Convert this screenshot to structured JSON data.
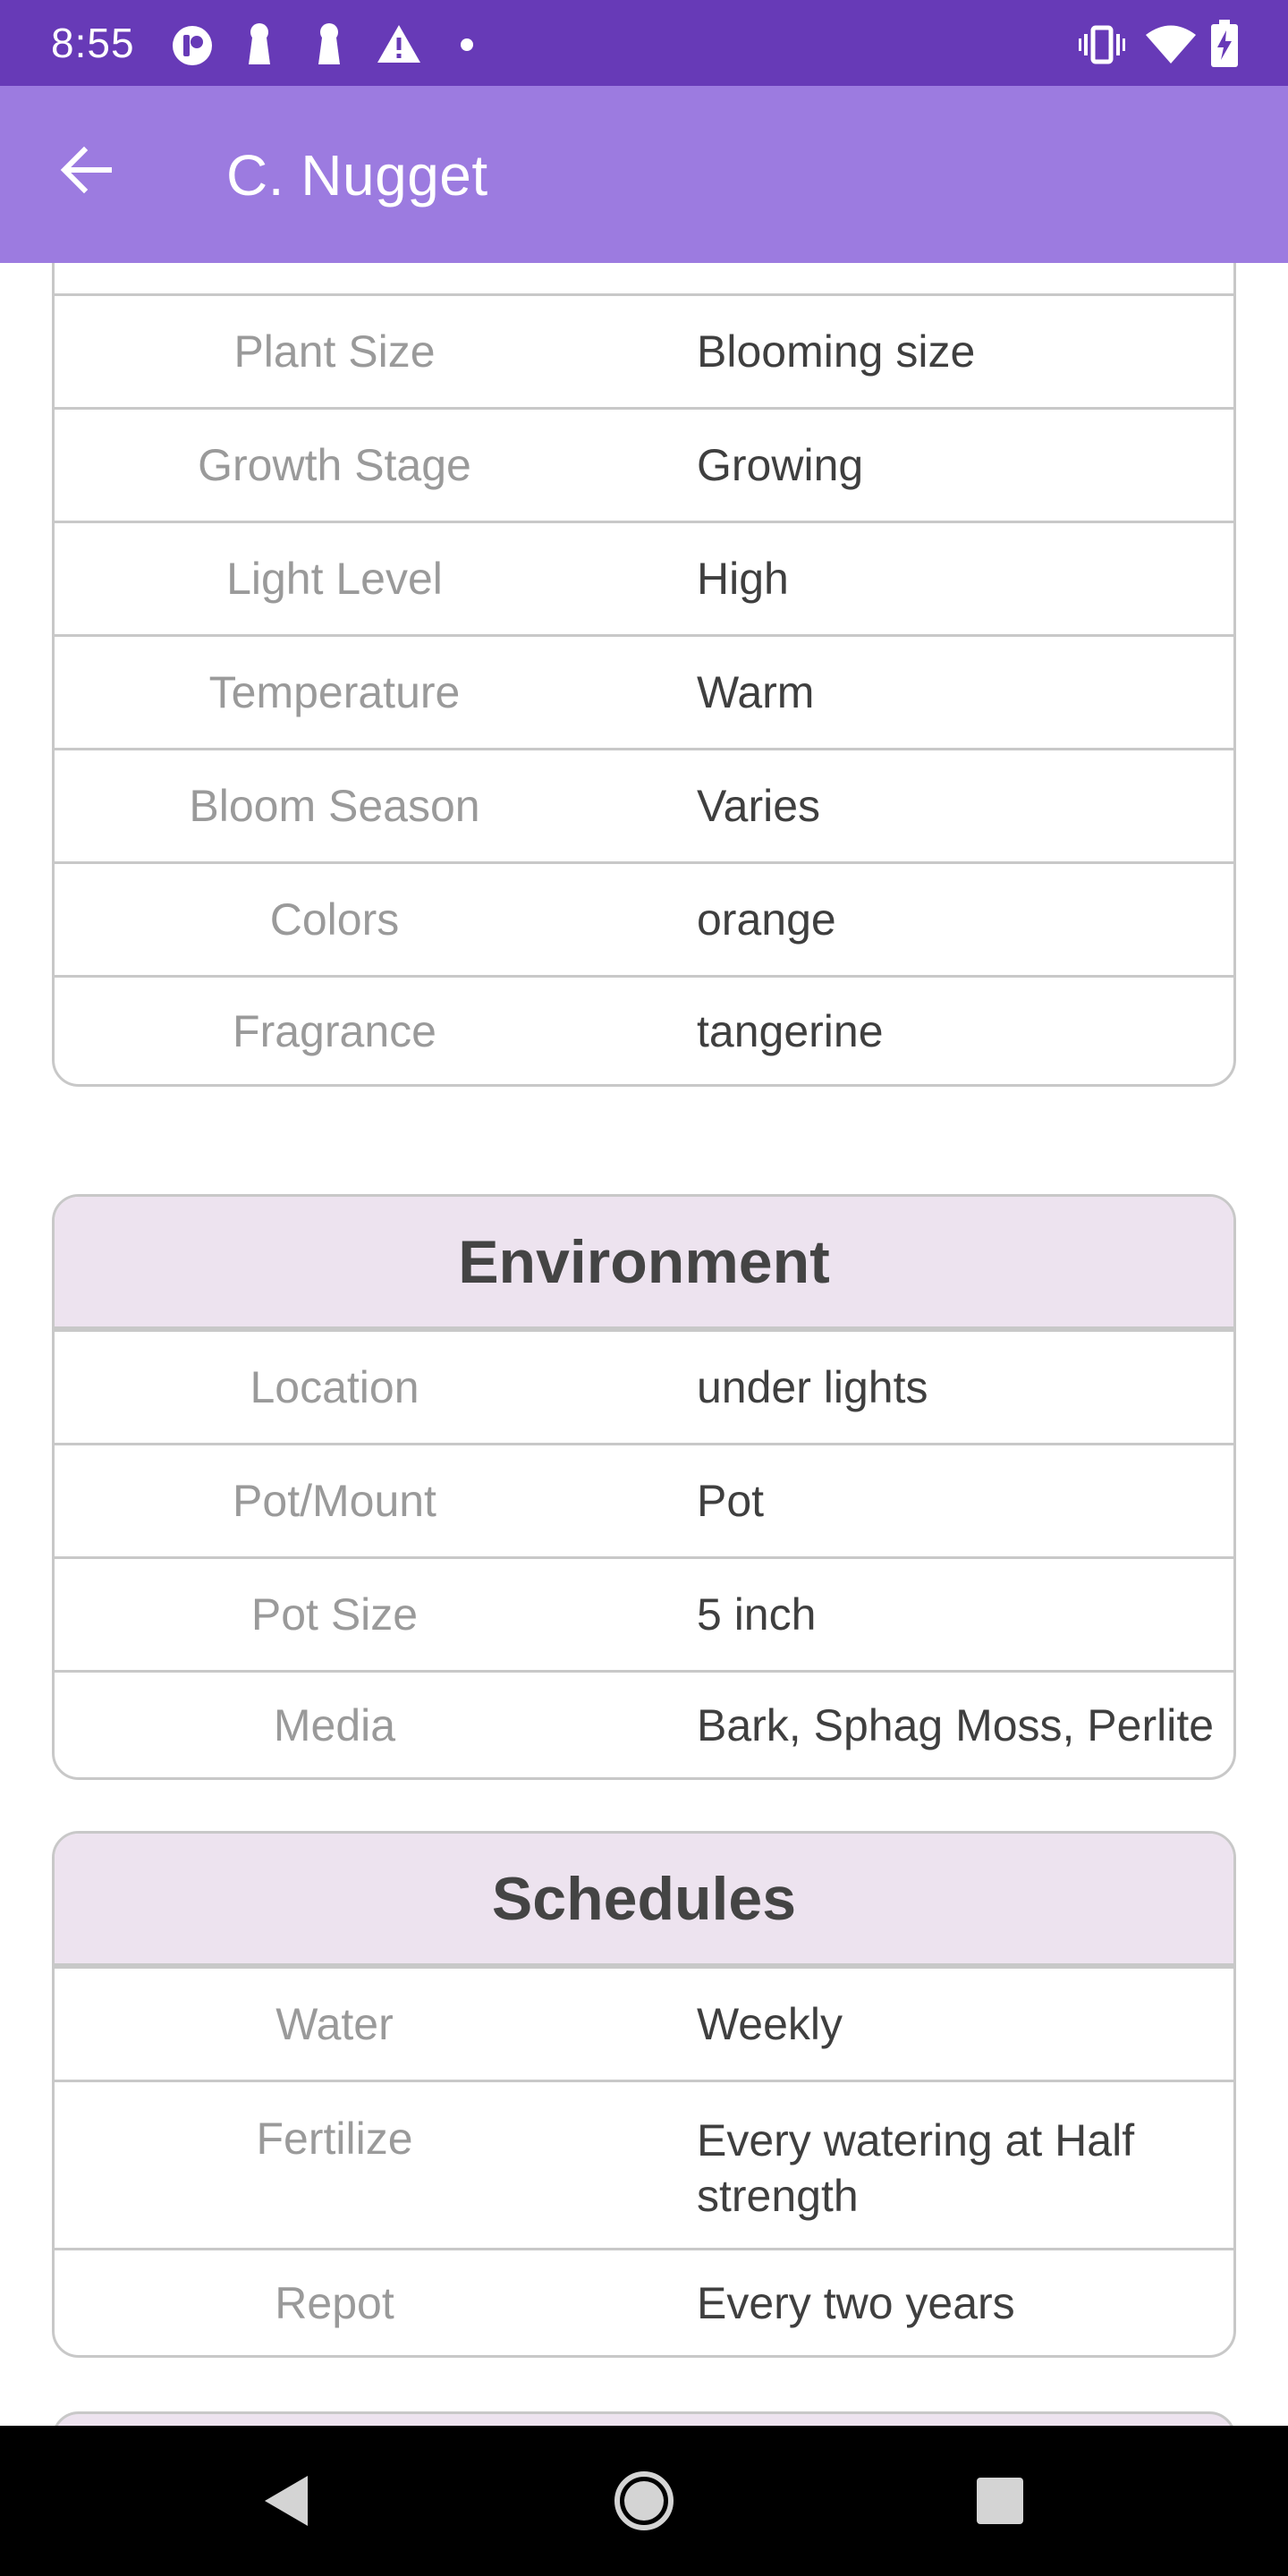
{
  "status_bar": {
    "time": "8:55",
    "left_icons": [
      "app-notification-icon",
      "keyhole-icon",
      "keyhole-icon",
      "warning-icon",
      "dot-icon"
    ],
    "right_icons": [
      "vibrate-icon",
      "wifi-icon",
      "battery-charging-icon"
    ]
  },
  "app_bar": {
    "back_icon": "arrow-back-icon",
    "title": "C. Nugget"
  },
  "details_card": {
    "rows": [
      {
        "label": "Plant Size",
        "value": "Blooming size"
      },
      {
        "label": "Growth Stage",
        "value": "Growing"
      },
      {
        "label": "Light Level",
        "value": "High"
      },
      {
        "label": "Temperature",
        "value": "Warm"
      },
      {
        "label": "Bloom Season",
        "value": "Varies"
      },
      {
        "label": "Colors",
        "value": "orange"
      },
      {
        "label": "Fragrance",
        "value": "tangerine"
      }
    ]
  },
  "environment_card": {
    "title": "Environment",
    "rows": [
      {
        "label": "Location",
        "value": "under lights"
      },
      {
        "label": "Pot/Mount",
        "value": "Pot"
      },
      {
        "label": "Pot Size",
        "value": "5 inch"
      },
      {
        "label": "Media",
        "value": "Bark, Sphag Moss, Perlite"
      }
    ]
  },
  "schedules_card": {
    "title": "Schedules",
    "rows": [
      {
        "label": "Water",
        "value": "Weekly"
      },
      {
        "label": "Fertilize",
        "value": "Every watering at Half strength"
      },
      {
        "label": "Repot",
        "value": "Every two years"
      }
    ]
  },
  "nav_bar": {
    "buttons": [
      "nav-back-icon",
      "nav-home-icon",
      "nav-recents-icon"
    ]
  },
  "colors": {
    "status_bar": "#673ab7",
    "app_bar": "#9c7be0",
    "card_header": "#ede3ef",
    "label_text": "#9a9a9a",
    "value_text": "#3f3f3f"
  }
}
